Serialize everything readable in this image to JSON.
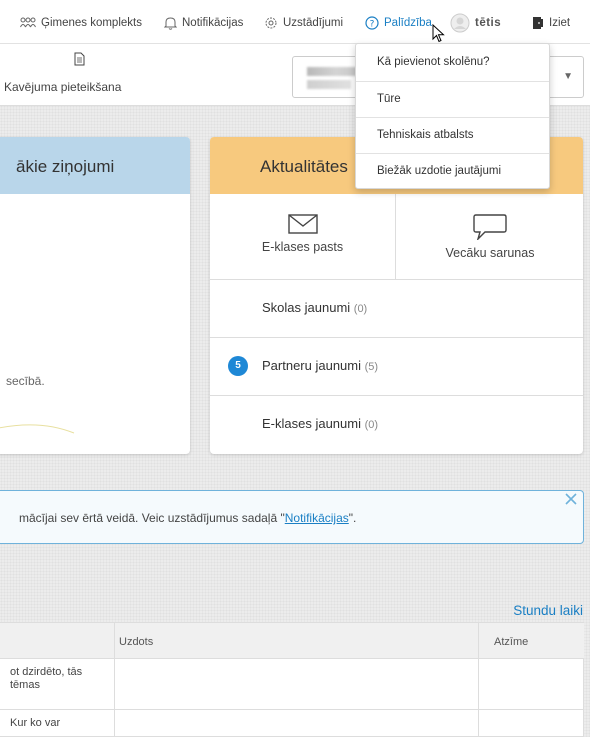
{
  "topbar": {
    "family_label": "Ģimenes komplekts",
    "notifications_label": "Notifikācijas",
    "settings_label": "Uzstādījumi",
    "help_label": "Palīdzība",
    "user_label": "tētis",
    "logout_label": "Iziet"
  },
  "subbar": {
    "late_entry_label": "Kavējuma pieteikšana",
    "student_select_value": ""
  },
  "left_card": {
    "title": "ākie ziņojumi",
    "partial_text": "secībā."
  },
  "news_card": {
    "title": "Aktualitātes",
    "mail_label": "E-klases pasts",
    "chat_label": "Vecāku sarunas",
    "school_news_label": "Skolas jaunumi",
    "school_news_count": "(0)",
    "partner_news_label": "Partneru jaunumi",
    "partner_news_count": "(5)",
    "partner_news_badge": "5",
    "eklase_news_label": "E-klases jaunumi",
    "eklase_news_count": "(0)"
  },
  "notif_banner": {
    "text_before": "mācījai sev ērtā veidā. Veic uzstādījumus sadaļā \"",
    "link_label": "Notifikācijas",
    "text_after": "\"."
  },
  "schedule": {
    "link_label": "Stundu laiki",
    "columns": [
      "Uzdots",
      "Atzīme"
    ],
    "rows": [
      {
        "col0": "ot dzirdēto, tās tēmas",
        "uzdots": "",
        "atzime": ""
      },
      {
        "col0": "Kur ko var",
        "uzdots": "",
        "atzime": ""
      }
    ]
  },
  "help_menu": {
    "items": [
      "Kā pievienot skolēnu?",
      "Tūre",
      "Tehniskais atbalsts",
      "Biežāk uzdotie jautājumi"
    ]
  },
  "colors": {
    "accent": "#1a7fc4",
    "left_card_header": "#b9d6ea",
    "news_card_header": "#f7c97e",
    "badge": "#1e88d6"
  }
}
